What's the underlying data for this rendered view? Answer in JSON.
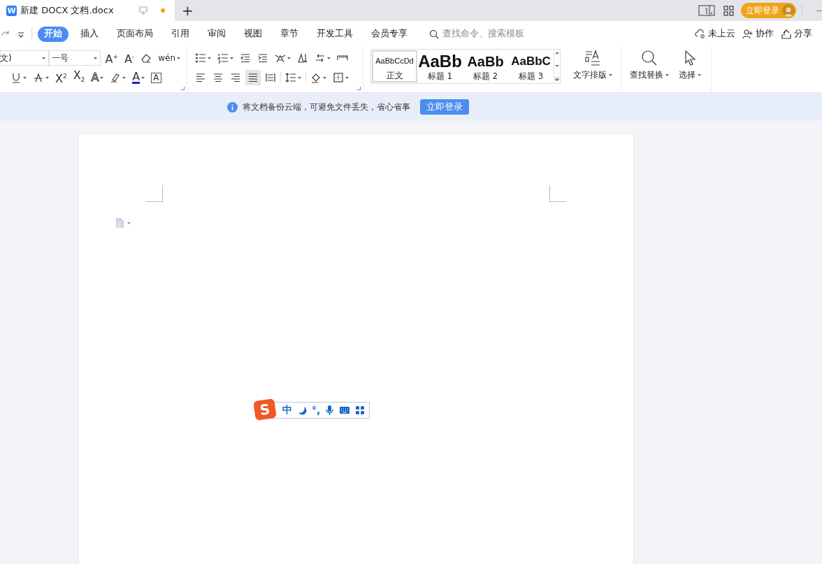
{
  "title_bar": {
    "app_logo": "W",
    "document_tab": {
      "title": "新建 DOCX 文档.docx",
      "unsaved": true
    },
    "new_tab": "+",
    "login_button": "立即登录"
  },
  "menu_bar": {
    "tabs": [
      {
        "label": "开始",
        "selected": true
      },
      {
        "label": "插入",
        "selected": false
      },
      {
        "label": "页面布局",
        "selected": false
      },
      {
        "label": "引用",
        "selected": false
      },
      {
        "label": "审阅",
        "selected": false
      },
      {
        "label": "视图",
        "selected": false
      },
      {
        "label": "章节",
        "selected": false
      },
      {
        "label": "开发工具",
        "selected": false
      },
      {
        "label": "会员专享",
        "selected": false
      }
    ],
    "search": {
      "placeholder": "查找命令、搜索模板"
    },
    "actions": [
      "未上云",
      "协作",
      "分享"
    ]
  },
  "ribbon": {
    "font": {
      "name": "文)",
      "size": "一号",
      "grow": "A$^{+}$",
      "shrink": "A$^{-}$",
      "phonetic": "wén",
      "superscript": "X$^{2}$",
      "subscript": "X$_{2}$",
      "effects": "A",
      "font_color": "A",
      "border": "A"
    },
    "paragraph": {
      "alignments": [
        {
          "selected": false
        },
        {
          "selected": false
        },
        {
          "selected": false
        },
        {
          "selected": true
        },
        {
          "selected": false
        }
      ]
    },
    "styles": [
      {
        "preview": "AaBbCcDd",
        "label": "正文",
        "selected": true
      },
      {
        "preview": "AaBb",
        "label": "标题 1",
        "selected": false
      },
      {
        "preview": "AaBb",
        "label": "标题 2",
        "selected": false
      },
      {
        "preview": "AaBbC",
        "label": "标题 3",
        "selected": false
      }
    ],
    "large_buttons": [
      "文字排版",
      "查找替换",
      "选择"
    ]
  },
  "notice": {
    "text": "将文档备份云端，可避免文件丢失，省心省事",
    "button": "立即登录"
  },
  "ime_toolbar": {
    "logo": "S",
    "mode": "中",
    "punctuation": "°,"
  }
}
